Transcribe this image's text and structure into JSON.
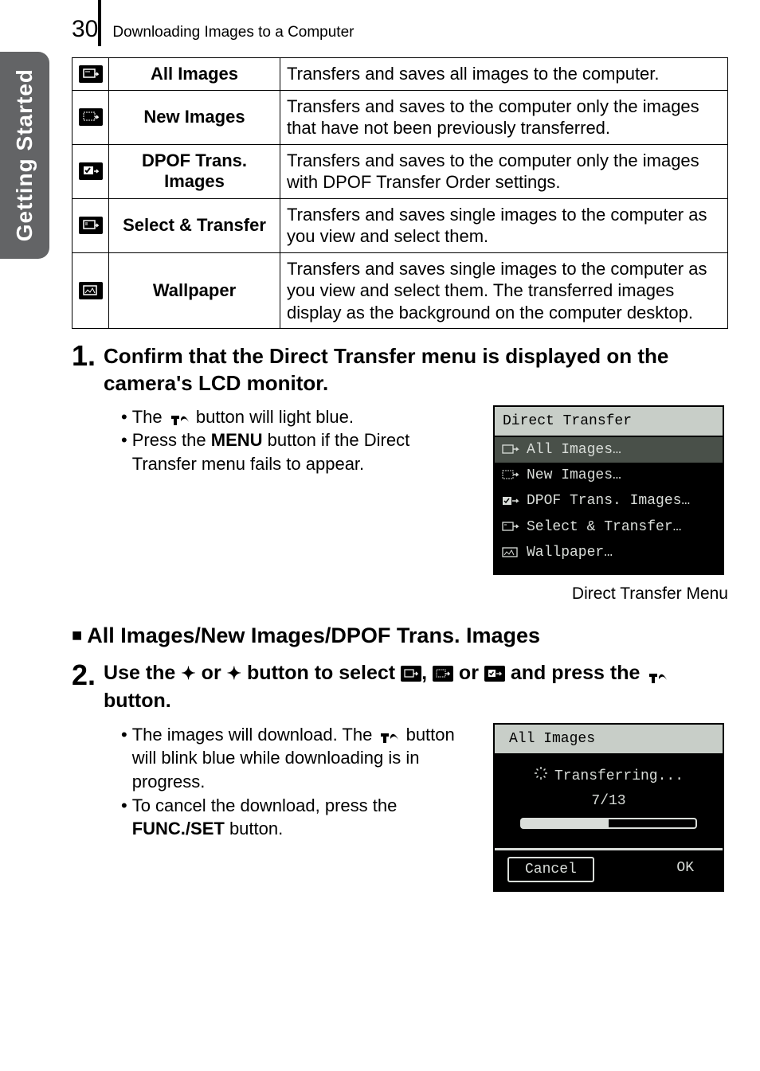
{
  "sidebar": {
    "label": "Getting Started"
  },
  "header": {
    "page_number": "30",
    "title": "Downloading Images to a Computer"
  },
  "options_table": [
    {
      "label": "All Images",
      "desc": "Transfers and saves all images to the computer."
    },
    {
      "label": "New Images",
      "desc": "Transfers and saves to the computer only the images that have not been previously transferred."
    },
    {
      "label": "DPOF Trans. Images",
      "desc": "Transfers and saves to the computer only the images with DPOF Transfer Order settings."
    },
    {
      "label": "Select & Transfer",
      "desc": "Transfers and saves single images to the computer as you view and select them."
    },
    {
      "label": "Wallpaper",
      "desc": "Transfers and saves single images to the computer as you view and select them. The transferred images display as the background on the computer desktop."
    }
  ],
  "step1": {
    "num": "1.",
    "title": "Confirm that the Direct Transfer menu is displayed on the camera's LCD monitor.",
    "bullet1_a": "The ",
    "bullet1_b": " button will light blue.",
    "bullet2_a": "Press the ",
    "bullet2_menu": "MENU",
    "bullet2_b": " button if the Direct Transfer menu fails to appear.",
    "lcd_title": "Direct Transfer",
    "lcd_items": [
      "All Images…",
      "New Images…",
      "DPOF Trans. Images…",
      "Select & Transfer…",
      "Wallpaper…"
    ],
    "caption": "Direct Transfer Menu"
  },
  "section2_heading": "All Images/New Images/DPOF Trans. Images",
  "step2": {
    "num": "2.",
    "title_a": "Use the ",
    "title_b": " or ",
    "title_c": " button to select ",
    "comma": ", ",
    "title_d": " or ",
    "title_e": " and press the ",
    "title_f": " button.",
    "bullet1_a": "The images will download. The ",
    "bullet1_b": " button will blink blue while downloading is in progress.",
    "bullet2_a": "To cancel the download, press the ",
    "bullet2_func": "FUNC./SET",
    "bullet2_b": " button.",
    "lcd_title": "All Images",
    "transferring": "Transferring...",
    "progress": "7/13",
    "cancel": "Cancel",
    "ok": "OK"
  }
}
